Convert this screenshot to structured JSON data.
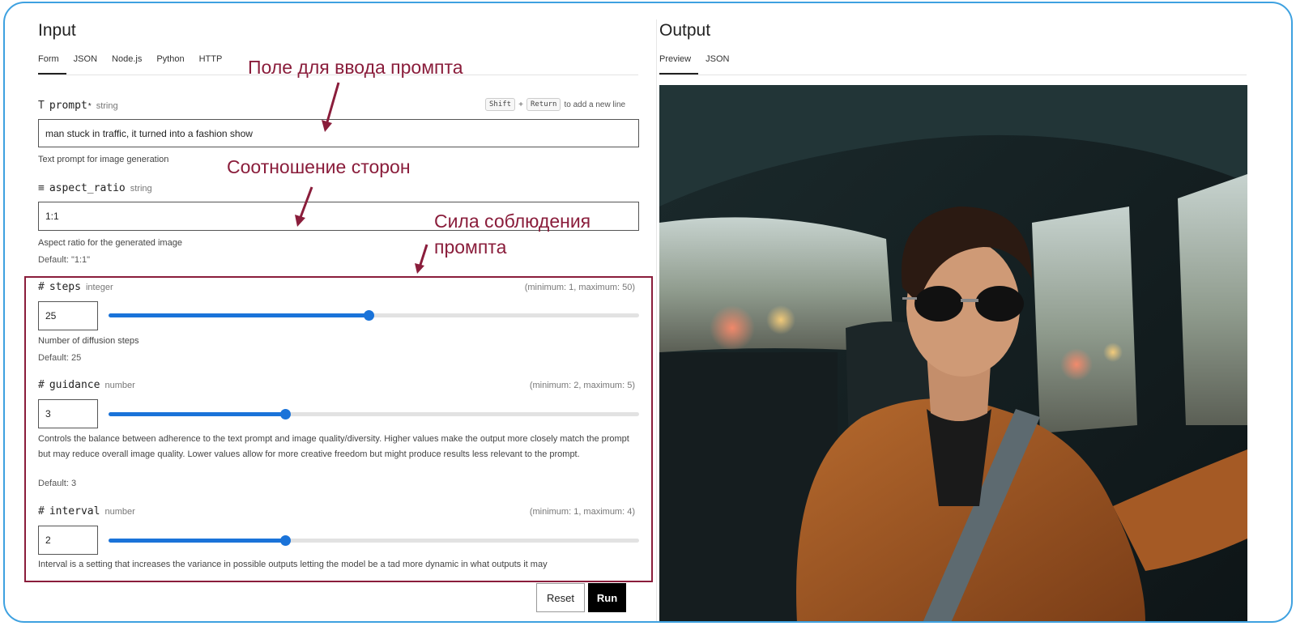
{
  "input": {
    "title": "Input",
    "tabs": [
      "Form",
      "JSON",
      "Node.js",
      "Python",
      "HTTP"
    ],
    "active_tab": "Form",
    "prompt": {
      "icon": "T",
      "name": "prompt",
      "required_mark": "*",
      "type": "string",
      "hint_key1": "Shift",
      "hint_plus": "+",
      "hint_key2": "Return",
      "hint_text": "to add a new line",
      "value": "man stuck in traffic, it turned into a fashion show",
      "description": "Text prompt for image generation"
    },
    "aspect_ratio": {
      "icon": "≡",
      "name": "aspect_ratio",
      "type": "string",
      "value": "1:1",
      "description": "Aspect ratio for the generated image",
      "default": "Default: \"1:1\""
    },
    "steps": {
      "icon": "#",
      "name": "steps",
      "type": "integer",
      "range": "(minimum: 1, maximum: 50)",
      "value": "25",
      "slider_fraction": 0.49,
      "description": "Number of diffusion steps",
      "default": "Default: 25"
    },
    "guidance": {
      "icon": "#",
      "name": "guidance",
      "type": "number",
      "range": "(minimum: 2, maximum: 5)",
      "value": "3",
      "slider_fraction": 0.333,
      "description": "Controls the balance between adherence to the text prompt and image quality/diversity. Higher values make the output more closely match the prompt but may reduce overall image quality. Lower values allow for more creative freedom but might produce results less relevant to the prompt.",
      "default": "Default: 3"
    },
    "interval": {
      "icon": "#",
      "name": "interval",
      "type": "number",
      "range": "(minimum: 1, maximum: 4)",
      "value": "2",
      "slider_fraction": 0.333,
      "description": "Interval is a setting that increases the variance in possible outputs letting the model be a tad more dynamic in what outputs it may"
    },
    "reset_label": "Reset",
    "run_label": "Run"
  },
  "output": {
    "title": "Output",
    "tabs": [
      "Preview",
      "JSON"
    ],
    "active_tab": "Preview"
  },
  "annotations": {
    "prompt_field": "Поле для ввода промпта",
    "aspect_ratio": "Соотношение сторон",
    "adherence_line1": "Сила соблюдения",
    "adherence_line2": "промпта"
  },
  "colors": {
    "accent": "#1a73d9",
    "annotation": "#8a1d3b",
    "frame_border": "#3ea1e0"
  }
}
